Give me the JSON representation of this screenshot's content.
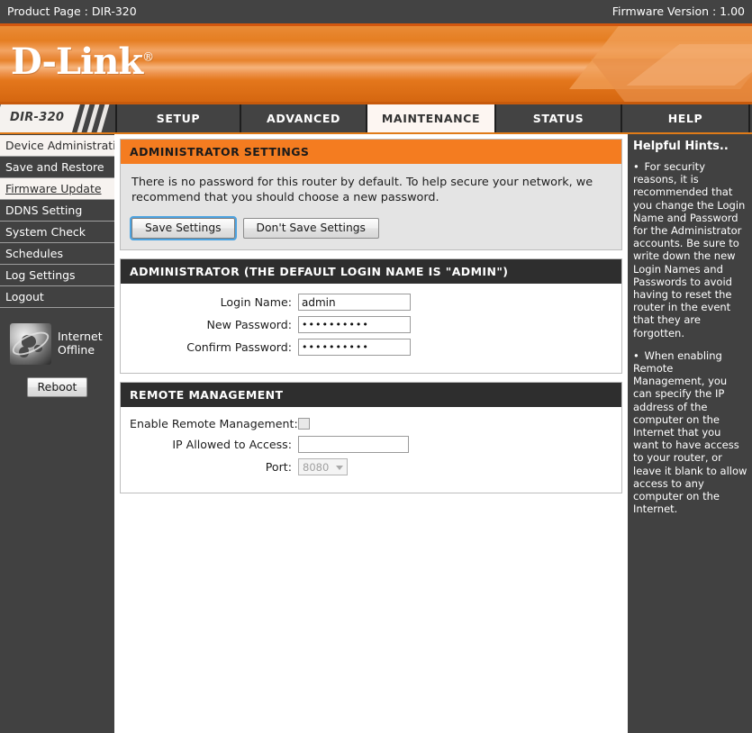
{
  "topbar": {
    "product_page_label": "Product Page :  DIR-320",
    "firmware_label": "Firmware Version : 1.00"
  },
  "brand": {
    "logo_text": "D-Link",
    "registered_mark": "®"
  },
  "nav": {
    "model_badge": "DIR-320",
    "tabs": [
      {
        "label": "SETUP",
        "active": false
      },
      {
        "label": "ADVANCED",
        "active": false
      },
      {
        "label": "MAINTENANCE",
        "active": true
      },
      {
        "label": "STATUS",
        "active": false
      },
      {
        "label": "HELP",
        "active": false
      }
    ]
  },
  "sidebar": {
    "items": [
      {
        "label": "Device Administration",
        "state": "selected"
      },
      {
        "label": "Save and Restore",
        "state": "normal"
      },
      {
        "label": "Firmware Update",
        "state": "hover"
      },
      {
        "label": "DDNS Setting",
        "state": "normal"
      },
      {
        "label": "System Check",
        "state": "normal"
      },
      {
        "label": "Schedules",
        "state": "normal"
      },
      {
        "label": "Log Settings",
        "state": "normal"
      },
      {
        "label": "Logout",
        "state": "normal"
      }
    ],
    "status": {
      "line1": "Internet",
      "line2": "Offline"
    },
    "reboot_label": "Reboot"
  },
  "main": {
    "admin_settings": {
      "title": "ADMINISTRATOR SETTINGS",
      "description": "There is no password for this router by default. To help secure your network, we recommend that you should choose a new password.",
      "save_label": "Save Settings",
      "dont_save_label": "Don't Save Settings"
    },
    "administrator": {
      "title": "ADMINISTRATOR (THE DEFAULT LOGIN NAME IS \"ADMIN\")",
      "fields": [
        {
          "label": "Login Name:",
          "value": "admin",
          "type": "text"
        },
        {
          "label": "New Password:",
          "value": "••••••••••",
          "type": "password"
        },
        {
          "label": "Confirm Password:",
          "value": "••••••••••",
          "type": "password"
        }
      ]
    },
    "remote_management": {
      "title": "REMOTE MANAGEMENT",
      "enable_label": "Enable Remote Management:",
      "enable_checked": false,
      "ip_label": "IP Allowed to Access:",
      "ip_value": "",
      "port_label": "Port:",
      "port_value": "8080"
    }
  },
  "hints": {
    "title": "Helpful Hints..",
    "items": [
      "For security reasons, it is recommended that you change the Login Name and Password for the Administrator accounts. Be sure to write down the new Login Names and Passwords to avoid having to reset the router in the event that they are forgotten.",
      "When enabling Remote Management, you can specify the IP address of the computer on the Internet that you want to have access to your router, or leave it blank to allow access to any computer on the Internet."
    ],
    "bullet": "•"
  },
  "colors": {
    "orange": "#f47c20",
    "dark_gray": "#414141",
    "panel_dark": "#2e2e2e",
    "accent_rule": "#d2570f"
  }
}
